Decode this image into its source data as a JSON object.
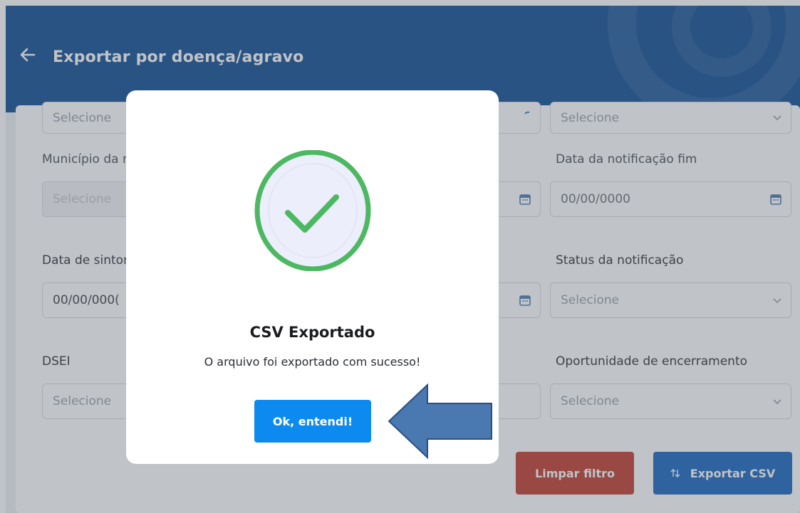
{
  "header": {
    "title": "Exportar por doença/agravo",
    "back_icon": "arrow-left-icon"
  },
  "colors": {
    "header_bg": "#0c4b91",
    "clear_button": "#c0392b",
    "export_button": "#1565c0",
    "ok_button": "#0d8af0",
    "success_green": "#4cb861",
    "annotation_arrow": "#4a78b0"
  },
  "form": {
    "row1": {
      "left_placeholder": "Selecione",
      "right_placeholder": "Selecione"
    },
    "municipio": {
      "label": "Município da r",
      "placeholder": "Selecione"
    },
    "data_notificacao_fim": {
      "label": "Data da notificação fim",
      "placeholder": "00/00/0000"
    },
    "data_sintomas": {
      "label": "Data de sintor",
      "placeholder": "00/00/000("
    },
    "status_notificacao": {
      "label": "Status da notificação",
      "placeholder": "Selecione"
    },
    "dsei": {
      "label": "DSEI",
      "placeholder": "Selecione"
    },
    "oportunidade": {
      "label": "Oportunidade de encerramento",
      "placeholder": "Selecione"
    }
  },
  "buttons": {
    "clear": "Limpar filtro",
    "export": "Exportar CSV",
    "export_icon": "sort-arrows-icon"
  },
  "modal": {
    "title": "CSV Exportado",
    "message": "O arquivo foi exportado com sucesso!",
    "ok_button": "Ok, entendi!",
    "icon": "check-circle-icon"
  }
}
